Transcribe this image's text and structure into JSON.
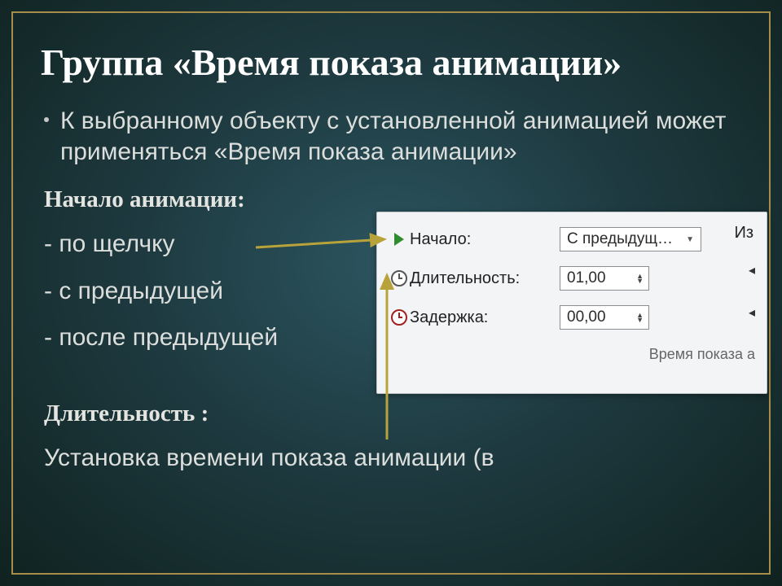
{
  "title": "Группа «Время показа анимации»",
  "bullet": "К выбранному объекту с установленной анимацией может применяться «Время показа анимации»",
  "startHead": "Начало анимации:",
  "startItems": [
    "- по щелчку",
    "- с предыдущей",
    "- после предыдущей"
  ],
  "durHead": "Длительность :",
  "durText": "Установка времени показа анимации (в",
  "panel": {
    "rows": [
      {
        "label": "Начало:",
        "value": "С предыдущ…",
        "kind": "dropdown",
        "icon": "play"
      },
      {
        "label": "Длительность:",
        "value": "01,00",
        "kind": "spinner",
        "icon": "clock"
      },
      {
        "label": "Задержка:",
        "value": "00,00",
        "kind": "spinner",
        "icon": "clock-red"
      }
    ],
    "cutRight": "Из",
    "caption": "Время показа а"
  }
}
